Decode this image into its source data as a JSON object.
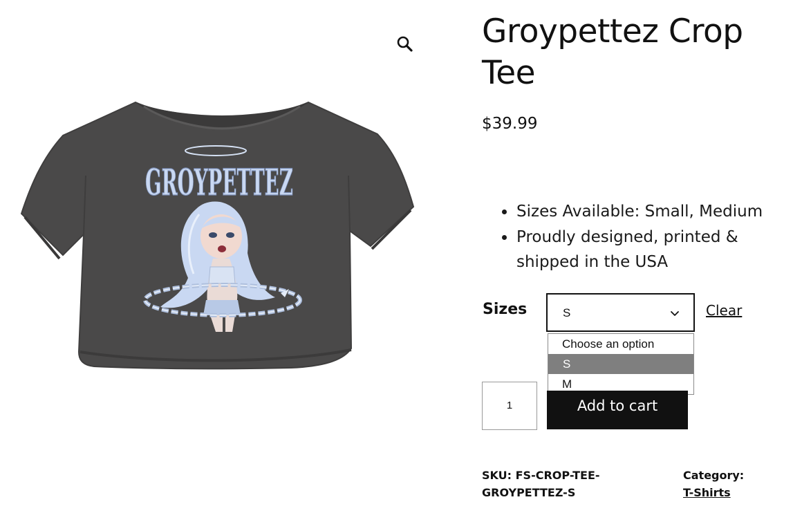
{
  "product": {
    "title_line1": "Groypettez Crop",
    "title_line2": "Tee",
    "price": "$39.99",
    "image": {
      "print_title": "GROYPETTEZ",
      "shirt_color": "#4a4949",
      "print_accent": "#c9d8f2"
    }
  },
  "features": [
    "Sizes Available: Small, Medium",
    "Proudly designed, printed & shipped in the USA"
  ],
  "variations": {
    "label": "Sizes",
    "selected": "S",
    "clear_label": "Clear",
    "options": [
      "Choose an option",
      "S",
      "M"
    ]
  },
  "cart": {
    "quantity": "1",
    "button_label": "Add to cart"
  },
  "meta": {
    "sku_label": "SKU:",
    "sku_value": "FS-CROP-TEE-GROYPETTEZ-S",
    "category_label": "Category:",
    "category_value": "T-Shirts"
  },
  "icons": {
    "zoom": "magnifier-icon",
    "select": "chevron-down-icon"
  },
  "colors": {
    "text": "#111111",
    "button_bg": "#111111",
    "button_text": "#ffffff",
    "option_highlight": "#7f7f7f"
  }
}
